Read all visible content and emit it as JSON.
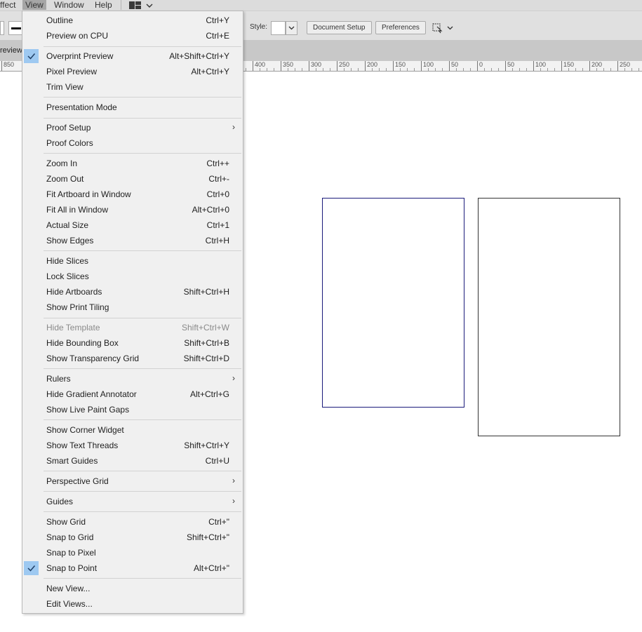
{
  "menubar": {
    "items": [
      "ffect",
      "View",
      "Window",
      "Help"
    ]
  },
  "controlbar": {
    "style_label": "Style:",
    "document_setup": "Document Setup",
    "preferences": "Preferences"
  },
  "tab": {
    "label": "review"
  },
  "ruler": {
    "labels": [
      "850",
      "400",
      "350",
      "300",
      "250",
      "200",
      "150",
      "100",
      "50",
      "0",
      "50",
      "100",
      "150",
      "200",
      "250"
    ]
  },
  "icons": {
    "checkmark": "check-icon",
    "submenu": "chevron-right-icon",
    "dropdown": "chevron-down-icon"
  },
  "colors": {
    "check_highlight": "#9ec9f1",
    "artboard_selected": "#1a1a7a",
    "menu_background": "#f0f0f0"
  },
  "view_menu": {
    "items": [
      {
        "label": "Outline",
        "shortcut": "Ctrl+Y"
      },
      {
        "label": "Preview on CPU",
        "shortcut": "Ctrl+E"
      },
      {
        "label": "Overprint Preview",
        "shortcut": "Alt+Shift+Ctrl+Y",
        "checked": true
      },
      {
        "label": "Pixel Preview",
        "shortcut": "Alt+Ctrl+Y"
      },
      {
        "label": "Trim View",
        "shortcut": ""
      },
      {
        "label": "Presentation Mode",
        "shortcut": ""
      },
      {
        "label": "Proof Setup",
        "shortcut": "",
        "submenu": true
      },
      {
        "label": "Proof Colors",
        "shortcut": ""
      },
      {
        "label": "Zoom In",
        "shortcut": "Ctrl++"
      },
      {
        "label": "Zoom Out",
        "shortcut": "Ctrl+-"
      },
      {
        "label": "Fit Artboard in Window",
        "shortcut": "Ctrl+0"
      },
      {
        "label": "Fit All in Window",
        "shortcut": "Alt+Ctrl+0"
      },
      {
        "label": "Actual Size",
        "shortcut": "Ctrl+1"
      },
      {
        "label": "Show Edges",
        "shortcut": "Ctrl+H"
      },
      {
        "label": "Hide Slices",
        "shortcut": ""
      },
      {
        "label": "Lock Slices",
        "shortcut": ""
      },
      {
        "label": "Hide Artboards",
        "shortcut": "Shift+Ctrl+H"
      },
      {
        "label": "Show Print Tiling",
        "shortcut": ""
      },
      {
        "label": "Hide Template",
        "shortcut": "Shift+Ctrl+W",
        "disabled": true
      },
      {
        "label": "Hide Bounding Box",
        "shortcut": "Shift+Ctrl+B"
      },
      {
        "label": "Show Transparency Grid",
        "shortcut": "Shift+Ctrl+D"
      },
      {
        "label": "Rulers",
        "shortcut": "",
        "submenu": true
      },
      {
        "label": "Hide Gradient Annotator",
        "shortcut": "Alt+Ctrl+G"
      },
      {
        "label": "Show Live Paint Gaps",
        "shortcut": ""
      },
      {
        "label": "Show Corner Widget",
        "shortcut": ""
      },
      {
        "label": "Show Text Threads",
        "shortcut": "Shift+Ctrl+Y"
      },
      {
        "label": "Smart Guides",
        "shortcut": "Ctrl+U"
      },
      {
        "label": "Perspective Grid",
        "shortcut": "",
        "submenu": true
      },
      {
        "label": "Guides",
        "shortcut": "",
        "submenu": true
      },
      {
        "label": "Show Grid",
        "shortcut": "Ctrl+\""
      },
      {
        "label": "Snap to Grid",
        "shortcut": "Shift+Ctrl+\""
      },
      {
        "label": "Snap to Pixel",
        "shortcut": ""
      },
      {
        "label": "Snap to Point",
        "shortcut": "Alt+Ctrl+\"",
        "checked": true
      },
      {
        "label": "New View...",
        "shortcut": ""
      },
      {
        "label": "Edit Views...",
        "shortcut": ""
      }
    ]
  }
}
